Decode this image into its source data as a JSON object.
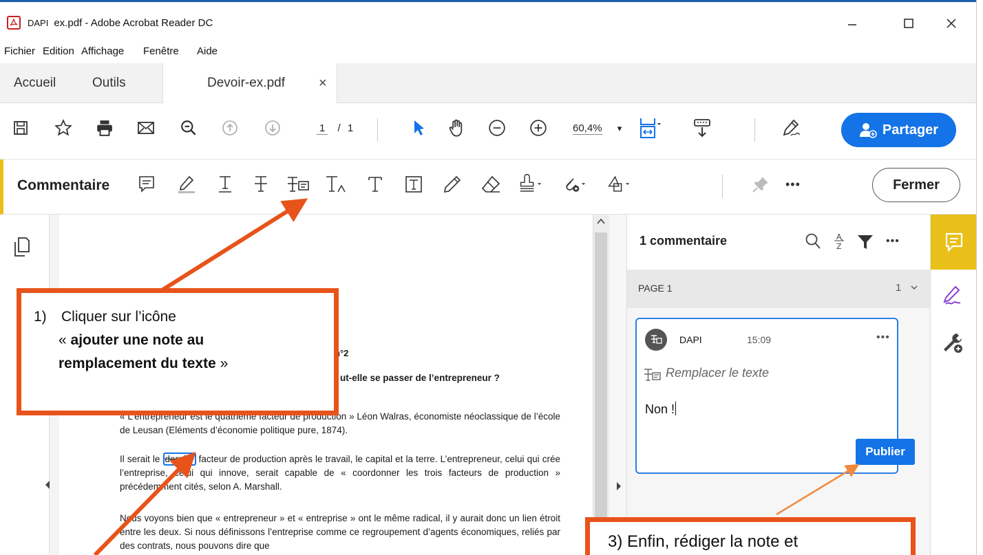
{
  "window": {
    "app_icon": "acrobat-icon",
    "title_prefix": "DAPI",
    "title": "ex.pdf - Adobe Acrobat Reader DC",
    "minimize": "—",
    "maximize": "☐",
    "close": "✕"
  },
  "menu": [
    "Fichier",
    "Edition",
    "Affichage",
    "Fenêtre",
    "Aide"
  ],
  "tabs": {
    "home": "Accueil",
    "tools": "Outils",
    "doc": "Devoir-ex.pdf",
    "doc_close": "×"
  },
  "toolbar": {
    "page_current": "1",
    "page_sep": "/",
    "page_total": "1",
    "zoom": "60,4%",
    "zoom_caret": "▾",
    "share": "Partager"
  },
  "comment_toolbar": {
    "label": "Commentaire",
    "more": "•••",
    "close": "Fermer"
  },
  "comments_panel": {
    "count_label": "1 commentaire",
    "more": "•••",
    "page_label": "PAGE 1",
    "page_count": "1",
    "card": {
      "author": "DAPI",
      "time": "15:09",
      "menu": "•••",
      "type": "Remplacer le texte",
      "text": "Non !",
      "publish": "Publier"
    }
  },
  "document": {
    "heading_partial": "n°2",
    "question_partial": "ut-elle se passer de l’entrepreneur ?",
    "p1": "« L’entrepreneur est le quatrième facteur de production » Léon Walras, économiste néoclassique de l’école de Leusan (Eléments d’économie politique pure, 1874).",
    "p2_before": "Il serait le ",
    "p2_highlight": "dernier",
    "p2_after": " facteur de production après le travail, le capital et la terre. L’entrepreneur, celui qui crée l’entreprise, celui qui innove, serait capable de « coordonner les trois facteurs de production » précédemment cités, selon A. Marshall.",
    "p3": "Nous voyons bien que « entrepreneur » et « entreprise » ont le même radical, il y aurait donc un lien étroit entre les deux. Si nous définissons l’entreprise comme ce regroupement d’agents économiques, reliés par des contrats, nous pouvons dire que"
  },
  "callouts": {
    "c1_num": "1)",
    "c1_line1": "Cliquer sur l’icône",
    "c1_line2_pre": "« ",
    "c1_line2_bold": "ajouter une note au",
    "c1_line3_bold": "remplacement du texte",
    "c1_line3_post": " »",
    "c3": "3)  Enfin, rédiger la note et"
  },
  "colors": {
    "accent": "#1473e6",
    "callout": "#e8531a",
    "comment_accent": "#e8c019"
  }
}
